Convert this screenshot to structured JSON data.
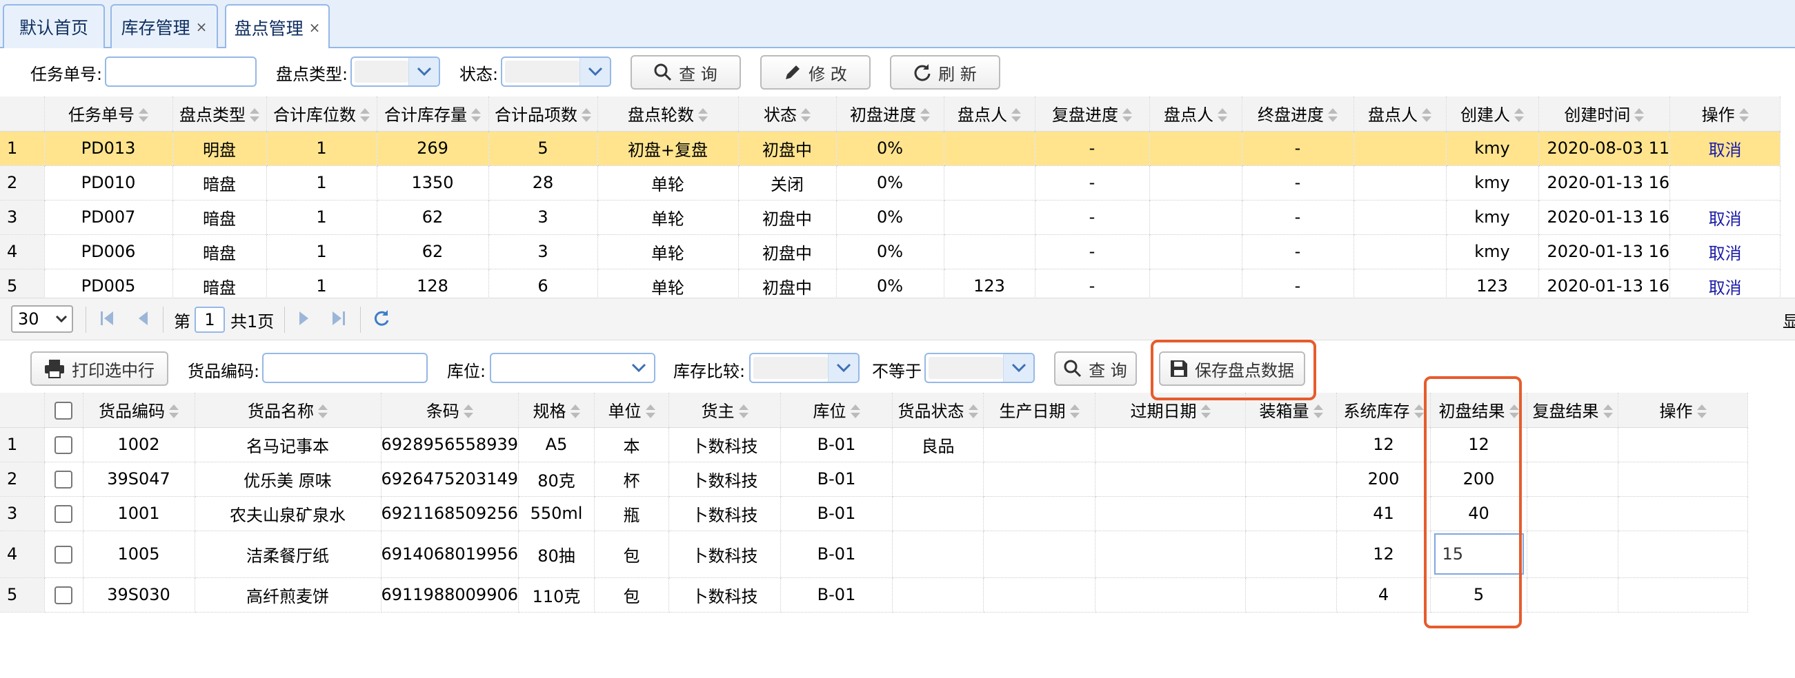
{
  "tabs": [
    {
      "label": "默认首页",
      "closable": false,
      "active": false
    },
    {
      "label": "库存管理",
      "closable": true,
      "active": false
    },
    {
      "label": "盘点管理",
      "closable": true,
      "active": true
    }
  ],
  "top_filter": {
    "task_no_label": "任务单号:",
    "task_no_value": "",
    "type_label": "盘点类型:",
    "type_value": "",
    "status_label": "状态:",
    "status_value": "",
    "query_label": "查 询",
    "edit_label": "修 改",
    "refresh_label": "刷 新",
    "close_symbol": "×"
  },
  "task_grid": {
    "columns": [
      "任务单号",
      "盘点类型",
      "合计库位数",
      "合计库存量",
      "合计品项数",
      "盘点轮数",
      "状态",
      "初盘进度",
      "盘点人",
      "复盘进度",
      "盘点人",
      "终盘进度",
      "盘点人",
      "创建人",
      "创建时间",
      "操作"
    ],
    "rows": [
      {
        "n": "1",
        "cells": [
          "PD013",
          "明盘",
          "1",
          "269",
          "5",
          "初盘+复盘",
          "初盘中",
          "0%",
          "",
          "-",
          "",
          "-",
          "",
          "kmy",
          "2020-08-03 11",
          "取消"
        ],
        "selected": true
      },
      {
        "n": "2",
        "cells": [
          "PD010",
          "暗盘",
          "1",
          "1350",
          "28",
          "单轮",
          "关闭",
          "0%",
          "",
          "-",
          "",
          "-",
          "",
          "kmy",
          "2020-01-13 16",
          ""
        ],
        "selected": false
      },
      {
        "n": "3",
        "cells": [
          "PD007",
          "暗盘",
          "1",
          "62",
          "3",
          "单轮",
          "初盘中",
          "0%",
          "",
          "-",
          "",
          "-",
          "",
          "kmy",
          "2020-01-13 16",
          "取消"
        ],
        "selected": false
      },
      {
        "n": "4",
        "cells": [
          "PD006",
          "暗盘",
          "1",
          "62",
          "3",
          "单轮",
          "初盘中",
          "0%",
          "",
          "-",
          "",
          "-",
          "",
          "kmy",
          "2020-01-13 16",
          "取消"
        ],
        "selected": false
      },
      {
        "n": "5",
        "cells": [
          "PD005",
          "暗盘",
          "1",
          "128",
          "6",
          "单轮",
          "初盘中",
          "0%",
          "123",
          "-",
          "",
          "-",
          "",
          "123",
          "2020-01-13 16",
          "取消"
        ],
        "selected": false
      }
    ]
  },
  "pager": {
    "page_size": "30",
    "page_prefix": "第",
    "page_value": "1",
    "page_suffix": "共1页",
    "right_edge_text": "显"
  },
  "detail_filter": {
    "print_label": "打印选中行",
    "code_label": "货品编码:",
    "code_value": "",
    "location_label": "库位:",
    "location_value": "",
    "compare_label": "库存比较:",
    "compare_value": "",
    "neq_label": "不等于",
    "neq_value": "",
    "query_label": "查 询",
    "save_label": "保存盘点数据"
  },
  "detail_grid": {
    "columns": [
      "货品编码",
      "货品名称",
      "条码",
      "规格",
      "单位",
      "货主",
      "库位",
      "货品状态",
      "生产日期",
      "过期日期",
      "装箱量",
      "系统库存",
      "初盘结果",
      "复盘结果",
      "操作"
    ],
    "rows": [
      {
        "n": "1",
        "cells": [
          "1002",
          "名马记事本",
          "6928956558939",
          "A5",
          "本",
          "卜数科技",
          "B-01",
          "良品",
          "",
          "",
          "",
          "12",
          "12",
          "",
          ""
        ]
      },
      {
        "n": "2",
        "cells": [
          "39S047",
          "优乐美 原味",
          "6926475203149",
          "80克",
          "杯",
          "卜数科技",
          "B-01",
          "",
          "",
          "",
          "",
          "200",
          "200",
          "",
          ""
        ]
      },
      {
        "n": "3",
        "cells": [
          "1001",
          "农夫山泉矿泉水",
          "6921168509256",
          "550ml",
          "瓶",
          "卜数科技",
          "B-01",
          "",
          "",
          "",
          "",
          "41",
          "40",
          "",
          ""
        ]
      },
      {
        "n": "4",
        "cells": [
          "1005",
          "洁柔餐厅纸",
          "6914068019956",
          "80抽",
          "包",
          "卜数科技",
          "B-01",
          "",
          "",
          "",
          "",
          "12",
          "15",
          "",
          ""
        ],
        "editing": true
      },
      {
        "n": "5",
        "cells": [
          "39S030",
          "高纤煎麦饼",
          "6911988009906",
          "110克",
          "包",
          "卜数科技",
          "B-01",
          "",
          "",
          "",
          "",
          "4",
          "5",
          "",
          ""
        ]
      }
    ]
  },
  "colors": {
    "highlight": "#e65c2c",
    "selected_row": "#ffe48d",
    "link": "#1c1ca8",
    "tab_border": "#95b8e7"
  }
}
